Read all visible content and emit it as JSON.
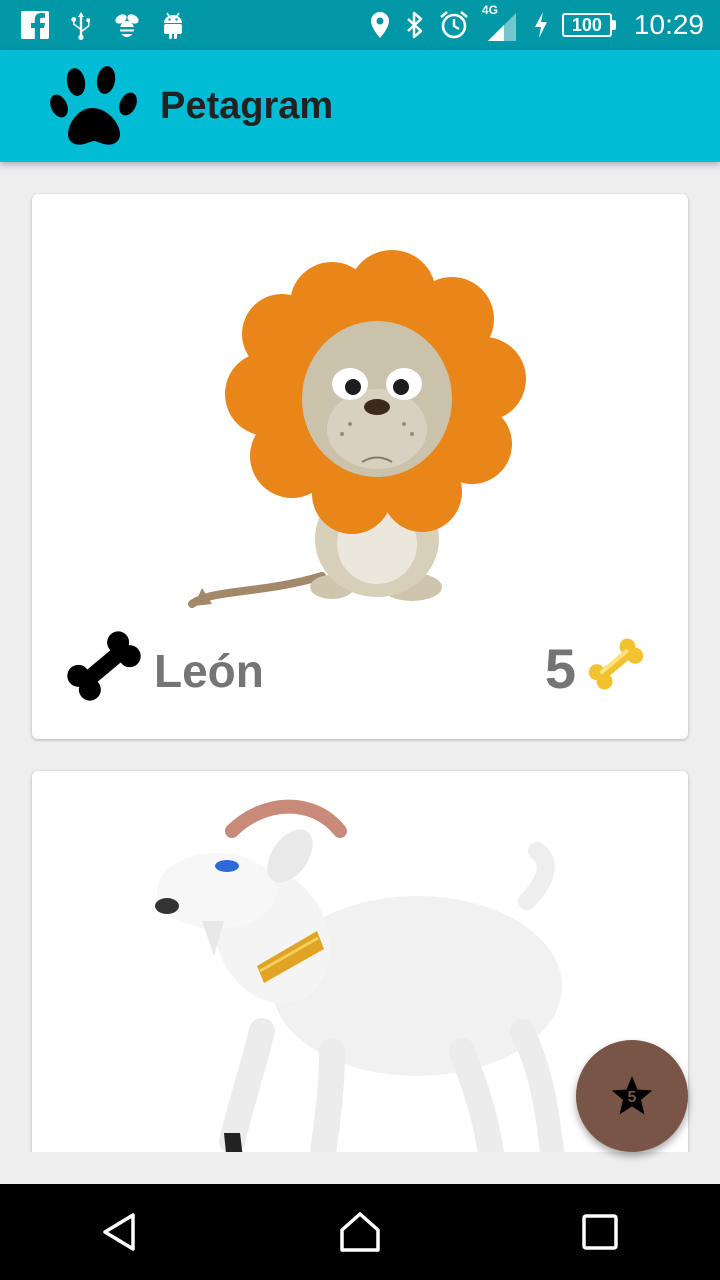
{
  "status_bar": {
    "icons": [
      "facebook-icon",
      "usb-icon",
      "bee-icon",
      "android-icon",
      "location-icon",
      "bluetooth-icon",
      "alarm-icon",
      "signal-icon",
      "charging-icon"
    ],
    "network": "4G",
    "battery": "100",
    "time": "10:29"
  },
  "app_bar": {
    "title": "Petagram",
    "logo_icon": "paw-icon"
  },
  "cards": [
    {
      "name": "León",
      "likes": "5",
      "image": "lion-illustration",
      "left_icon": "bone-icon",
      "right_icon": "golden-bone-icon"
    },
    {
      "image": "goat-illustration"
    }
  ],
  "fab": {
    "icon": "star-icon",
    "count": "5",
    "color": "#795548"
  },
  "nav_bar": {
    "buttons": [
      "back-icon",
      "home-icon",
      "recents-icon"
    ]
  },
  "colors": {
    "status_bar": "#0097a7",
    "app_bar": "#00bcd4",
    "background": "#eeeeee",
    "text_gray": "#757575"
  }
}
